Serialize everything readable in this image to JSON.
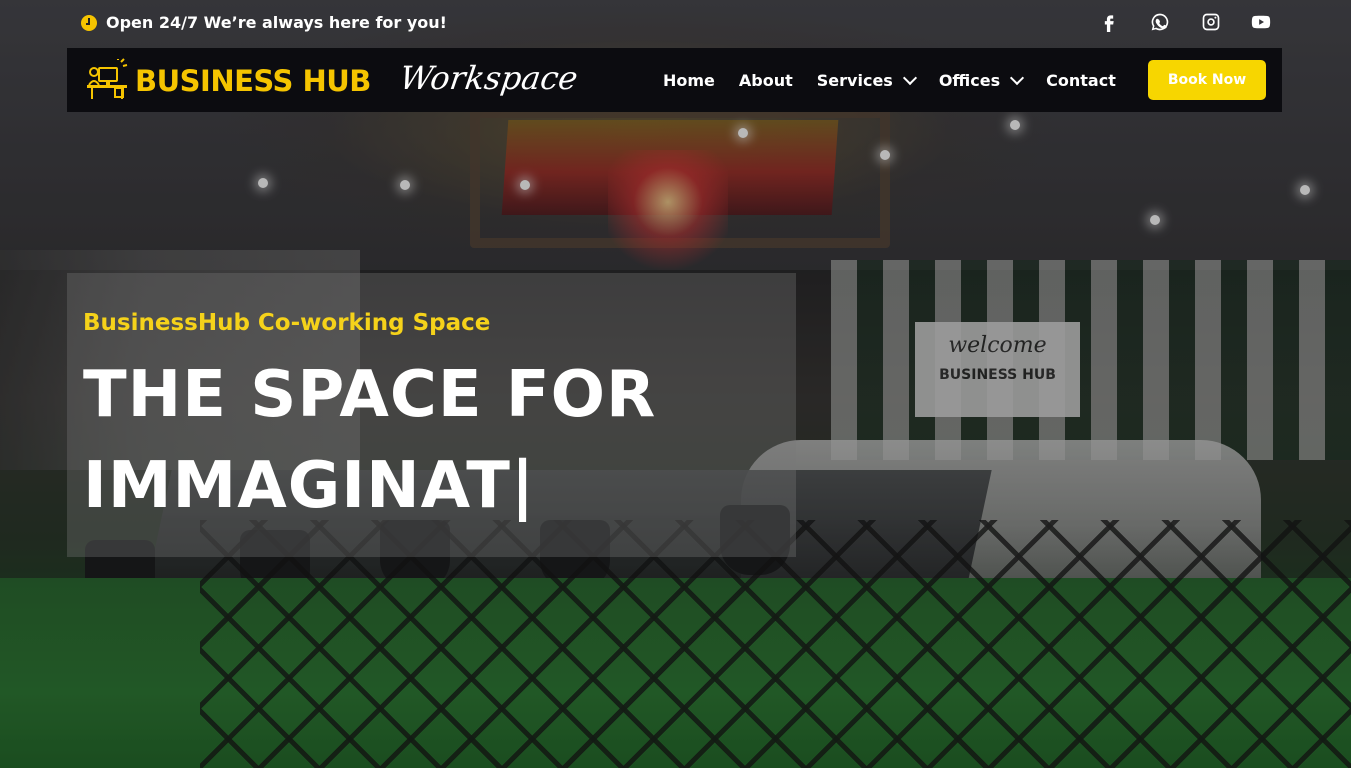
{
  "topbar": {
    "hours_text": "Open 24/7 We’re always here for you!",
    "social": [
      {
        "icon": "facebook-icon"
      },
      {
        "icon": "whatsapp-icon"
      },
      {
        "icon": "instagram-icon"
      },
      {
        "icon": "youtube-icon"
      }
    ]
  },
  "brand": {
    "name": "BUSINESS HUB",
    "tagline": "Workspace",
    "accent_color": "#f5c400"
  },
  "nav": {
    "items": [
      "Home",
      "About",
      "Services",
      "Offices",
      "Contact"
    ],
    "book_button": "Book Now"
  },
  "hero": {
    "subtitle": "BusinessHub Co-working Space",
    "title": "THE SPACE FOR IMMAGINAT|"
  },
  "background": {
    "sign_line1": "welcome",
    "sign_line2": "BUSINESS HUB"
  }
}
